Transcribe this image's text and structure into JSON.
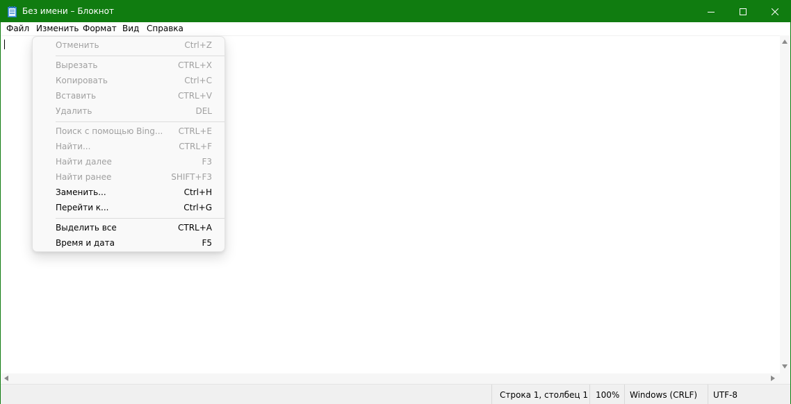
{
  "window": {
    "title": "Без имени – Блокнот",
    "accent_color": "#107c10",
    "controls": {
      "minimize": "minimize-icon",
      "maximize": "maximize-icon",
      "close": "close-icon"
    }
  },
  "menubar": {
    "file": "Файл",
    "edit": "Изменить",
    "format": "Формат",
    "view": "Вид",
    "help": "Справка"
  },
  "edit_menu": {
    "items": [
      {
        "label": "Отменить",
        "shortcut": "Ctrl+Z",
        "enabled": false
      },
      {
        "label": "Вырезать",
        "shortcut": "CTRL+X",
        "enabled": false
      },
      {
        "label": "Копировать",
        "shortcut": "Ctrl+C",
        "enabled": false
      },
      {
        "label": "Вставить",
        "shortcut": "CTRL+V",
        "enabled": false
      },
      {
        "label": "Удалить",
        "shortcut": "DEL",
        "enabled": false
      },
      {
        "label": "Поиск с помощью Bing...",
        "shortcut": "CTRL+E",
        "enabled": false
      },
      {
        "label": "Найти...",
        "shortcut": "CTRL+F",
        "enabled": false
      },
      {
        "label": "Найти далее",
        "shortcut": "F3",
        "enabled": false
      },
      {
        "label": "Найти ранее",
        "shortcut": "SHIFT+F3",
        "enabled": false
      },
      {
        "label": "Заменить...",
        "shortcut": "Ctrl+H",
        "enabled": true
      },
      {
        "label": "Перейти к...",
        "shortcut": "Ctrl+G",
        "enabled": true
      },
      {
        "label": "Выделить все",
        "shortcut": "CTRL+A",
        "enabled": true
      },
      {
        "label": "Время и дата",
        "shortcut": "F5",
        "enabled": true
      }
    ]
  },
  "editor": {
    "content": ""
  },
  "statusbar": {
    "position": "Строка 1, столбец 1",
    "zoom": "100%",
    "line_endings": "Windows (CRLF)",
    "encoding": "UTF-8"
  }
}
